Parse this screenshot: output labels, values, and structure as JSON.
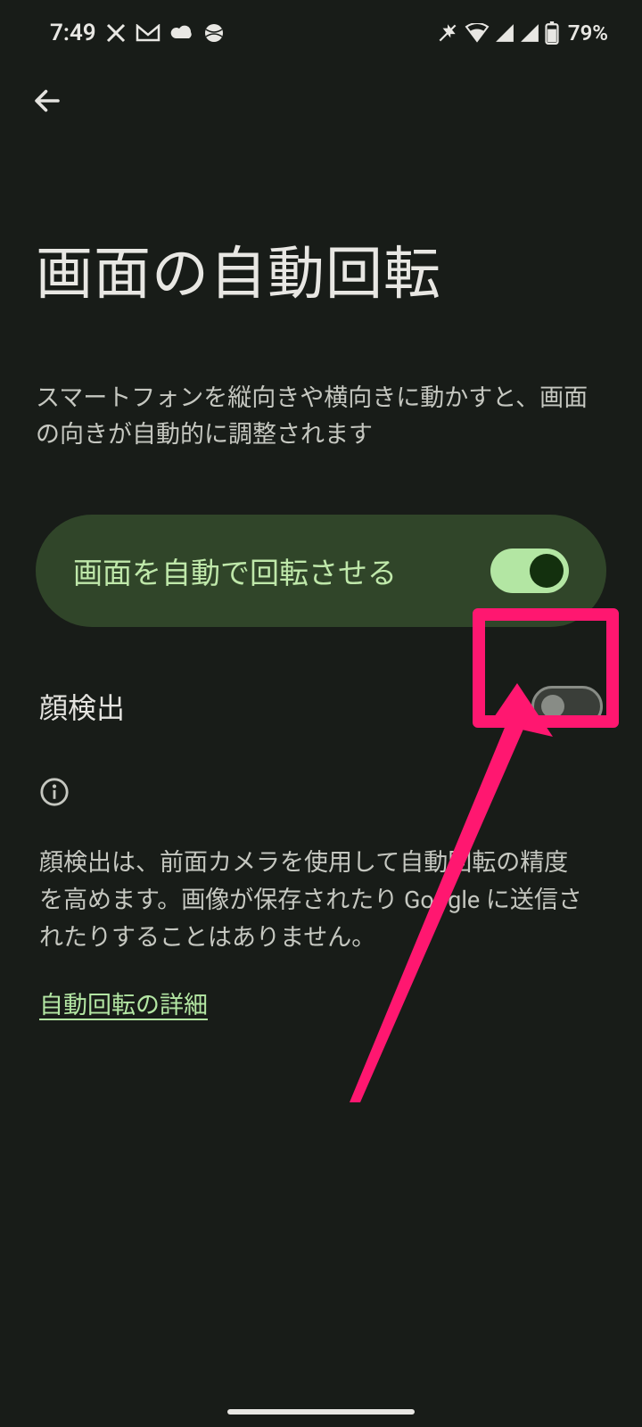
{
  "status": {
    "time": "7:49",
    "battery": "79%"
  },
  "page": {
    "title": "画面の自動回転",
    "description": "スマートフォンを縦向きや横向きに動かすと、画面の向きが自動的に調整されます"
  },
  "mainToggle": {
    "label": "画面を自動で回転させる",
    "on": true
  },
  "faceRow": {
    "label": "顔検出",
    "on": false
  },
  "info": {
    "text": "顔検出は、前面カメラを使用して自動回転の精度を高めます。画像が保存されたり Google に送信されたりすることはありません。",
    "link": "自動回転の詳細"
  }
}
